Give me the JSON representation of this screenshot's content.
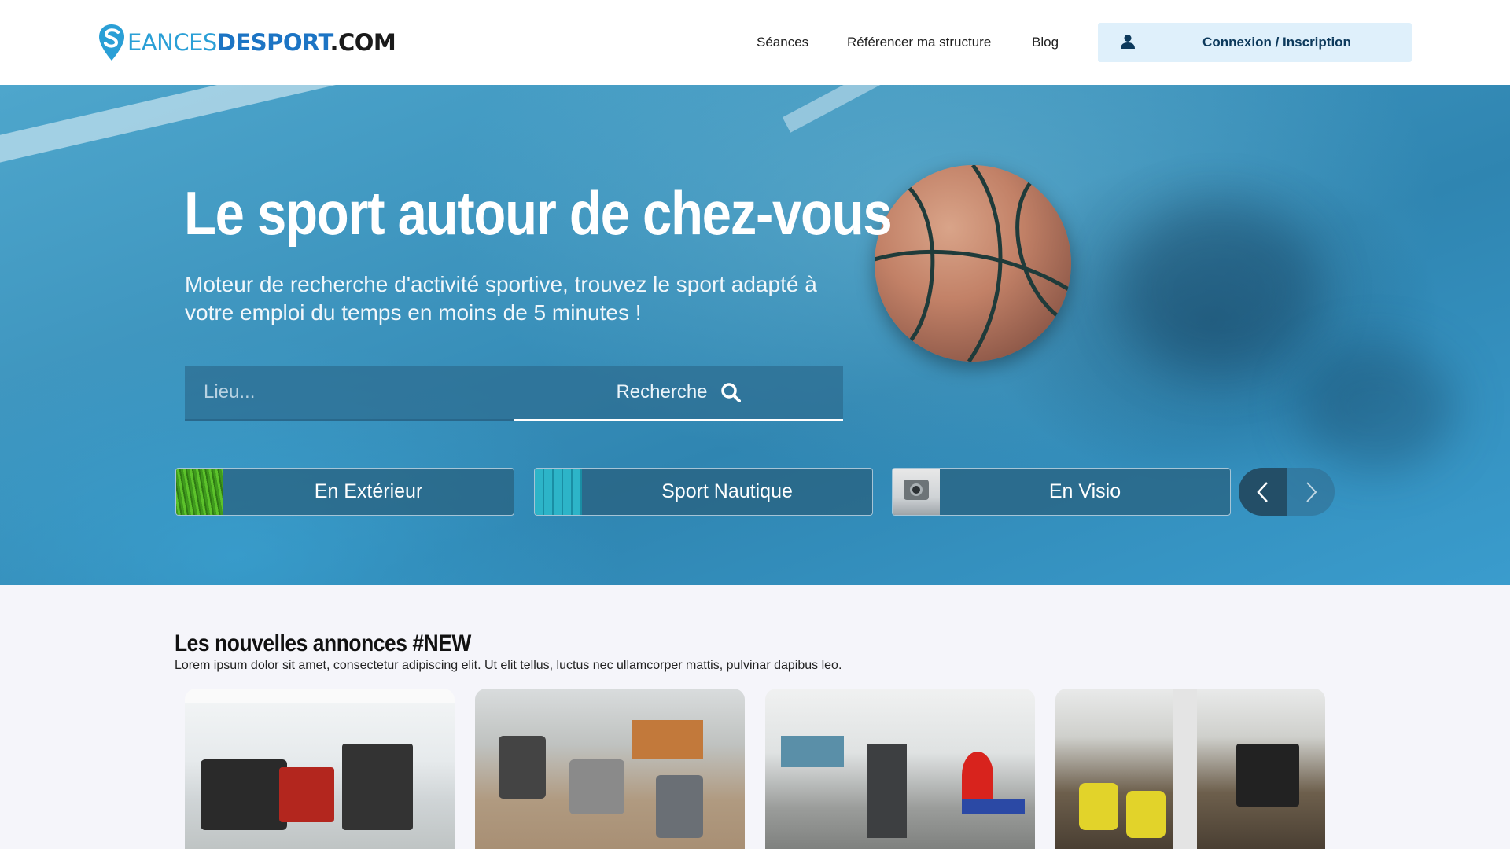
{
  "header": {
    "logo": {
      "part1": "EANCES",
      "part2": "DESPORT",
      "part3": ".COM"
    },
    "nav": [
      "Séances",
      "Référencer ma structure",
      "Blog"
    ],
    "login_label": "Connexion / Inscription"
  },
  "hero": {
    "title": "Le sport autour de chez-vous",
    "subtitle": "Moteur de recherche d'activité sportive, trouvez le sport adapté à votre emploi du temps en moins de 5 minutes !",
    "search": {
      "placeholder": "Lieu...",
      "button_label": "Recherche"
    },
    "categories": [
      {
        "label": "En Extérieur",
        "icon": "grass-thumbnail"
      },
      {
        "label": "Sport Nautique",
        "icon": "pool-thumbnail"
      },
      {
        "label": "En Visio",
        "icon": "webcam-thumbnail"
      }
    ]
  },
  "section": {
    "title": "Les nouvelles annonces #NEW",
    "description": "Lorem ipsum dolor sit amet, consectetur adipiscing elit. Ut elit tellus, luctus nec ullamcorper mattis, pulvinar dapibus leo."
  },
  "colors": {
    "accent": "#2a9fd6",
    "login_bg": "#dff0fb",
    "login_text": "#0d3a5c"
  }
}
